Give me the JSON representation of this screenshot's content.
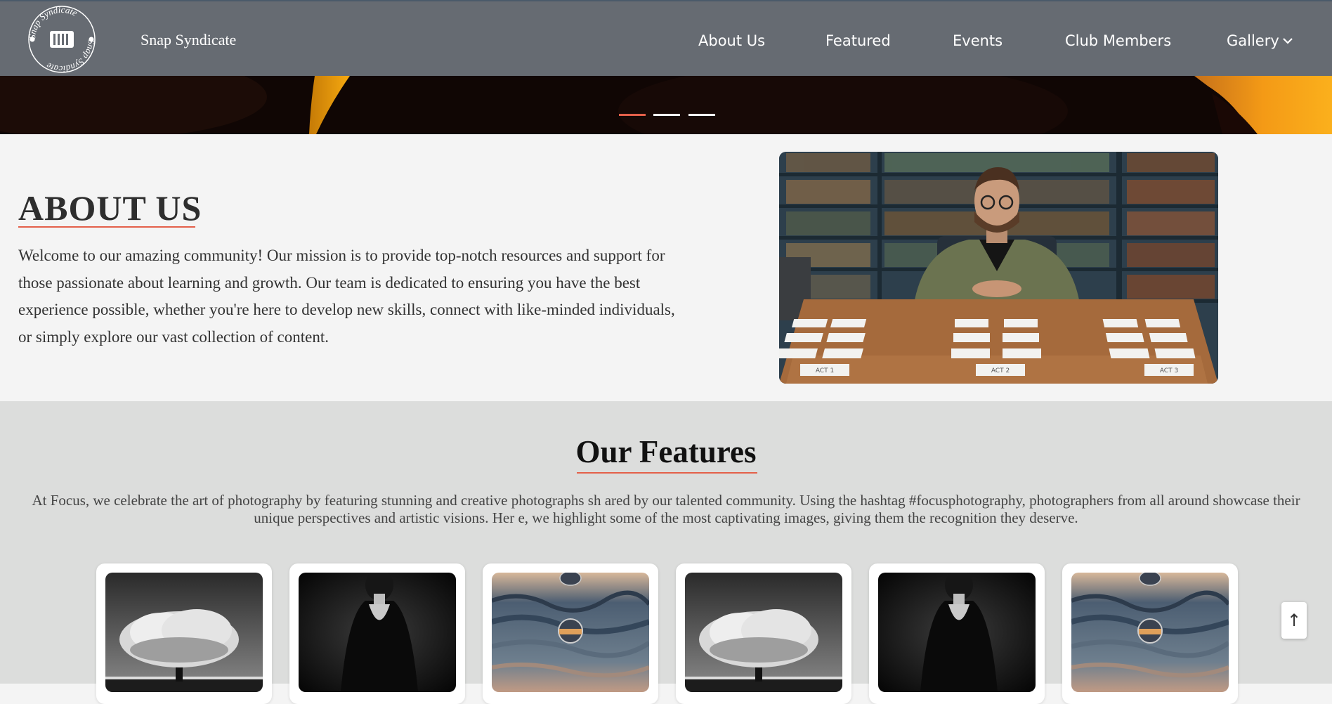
{
  "header": {
    "logo_ring_text": "Snap Syndicate",
    "brand": "Snap Syndicate",
    "nav": [
      {
        "label": "About Us"
      },
      {
        "label": "Featured"
      },
      {
        "label": "Events"
      },
      {
        "label": "Club Members"
      },
      {
        "label": "Gallery"
      }
    ]
  },
  "hero": {
    "slide_count": 3,
    "active_slide": 1,
    "active_color": "#e4604a"
  },
  "about": {
    "title": "ABOUT US",
    "text": "Welcome to our amazing community! Our mission is to provide top-notch resources and support for those passionate about learning and growth. Our team is dedicated to ensuring you have the best experience possible, whether you're here to develop new skills, connect with like-minded individuals, or simply explore our vast collection of content.",
    "card_labels": [
      "ACT 1",
      "ACT 2",
      "ACT 3"
    ]
  },
  "features": {
    "title": "Our Features",
    "text": "At Focus, we celebrate the art of photography by featuring stunning and creative photographs sh ared by our talented community. Using the hashtag #focusphotography, photographers from all around showcase their unique perspectives and artistic visions. Her e, we highlight some of the most captivating images, giving them the recognition they deserve.",
    "cards": [
      {
        "subject": "tree"
      },
      {
        "subject": "woman"
      },
      {
        "subject": "waves"
      },
      {
        "subject": "tree"
      },
      {
        "subject": "woman"
      },
      {
        "subject": "waves"
      }
    ]
  },
  "scroll_top": {
    "icon": "arrow-up-icon",
    "label": "↑"
  },
  "colors": {
    "navbar": "#666b72",
    "accent": "#e4604a",
    "features_bg": "#dcdddc"
  }
}
